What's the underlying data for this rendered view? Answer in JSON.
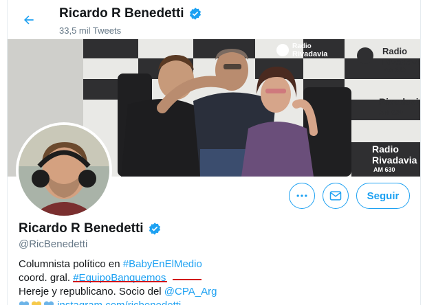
{
  "header": {
    "title": "Ricardo R Benedetti",
    "tweet_count": "33,5 mil Tweets"
  },
  "banner": {
    "sign_brand": "Radio",
    "sign_name": "Rivadavia",
    "sign_freq": "AM 630"
  },
  "actions": {
    "follow_label": "Seguir"
  },
  "profile": {
    "name": "Ricardo R Benedetti",
    "handle": "@RicBenedetti",
    "bio": {
      "line1_text": "Columnista político en ",
      "line1_link": "#BabyEnElMedio",
      "line2_text": "coord. gral. ",
      "line2_link": "#EquipoBanquemos",
      "line3_text": "Hereje y republicano. Socio del ",
      "line3_link": "@CPA_Arg",
      "line4_link": "instagram.com/ricbenedetti"
    }
  },
  "colors": {
    "accent": "#1da1f2",
    "text": "#14171a",
    "muted": "#657786",
    "annotation": "#d1101a"
  }
}
